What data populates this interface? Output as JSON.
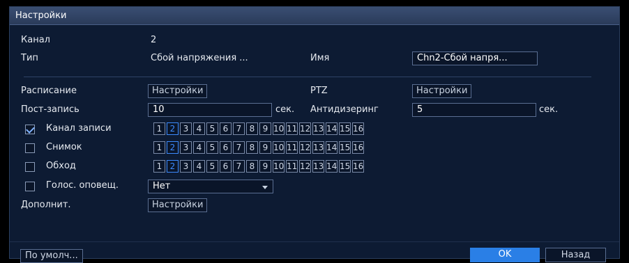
{
  "window": {
    "title": "Настройки"
  },
  "fields": {
    "channel_label": "Канал",
    "channel_value": "2",
    "type_label": "Тип",
    "type_value": "Сбой напряжения ...",
    "name_label": "Имя",
    "name_value": "Chn2-Сбой напря...",
    "schedule_label": "Расписание",
    "schedule_button": "Настройки",
    "ptz_label": "PTZ",
    "ptz_button": "Настройки",
    "post_record_label": "Пост-запись",
    "post_record_value": "10",
    "post_record_unit": "сек.",
    "antidither_label": "Антидизеринг",
    "antidither_value": "5",
    "antidither_unit": "сек.",
    "record_channel_label": "Канал записи",
    "record_channel_checked": true,
    "snapshot_label": "Снимок",
    "snapshot_checked": false,
    "tour_label": "Обход",
    "tour_checked": false,
    "voice_label": "Голос. оповещ.",
    "voice_checked": false,
    "voice_select_value": "Нет",
    "extra_label": "Дополнит.",
    "extra_button": "Настройки"
  },
  "channels": [
    "1",
    "2",
    "3",
    "4",
    "5",
    "6",
    "7",
    "8",
    "9",
    "10",
    "11",
    "12",
    "13",
    "14",
    "15",
    "16"
  ],
  "selected_channel": "2",
  "footer": {
    "default_button": "По умолч...",
    "ok_button": "OK",
    "back_button": "Назад"
  },
  "colors": {
    "accent": "#2a7fe6",
    "background": "#0d1b33",
    "selected_channel": "#3d8bff"
  }
}
